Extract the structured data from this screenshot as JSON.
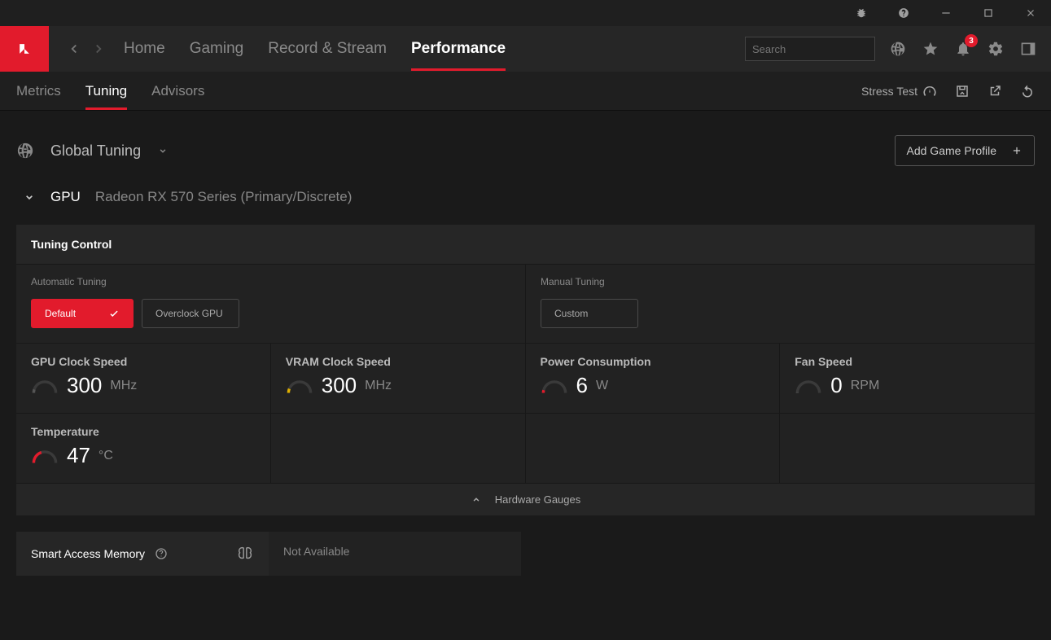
{
  "nav": {
    "home": "Home",
    "gaming": "Gaming",
    "record": "Record & Stream",
    "performance": "Performance"
  },
  "search": {
    "placeholder": "Search"
  },
  "notifications": {
    "count": "3"
  },
  "subtabs": {
    "metrics": "Metrics",
    "tuning": "Tuning",
    "advisors": "Advisors"
  },
  "subright": {
    "stress": "Stress Test"
  },
  "tuning": {
    "scope": "Global Tuning",
    "add_profile": "Add Game Profile",
    "gpu_label": "GPU",
    "gpu_name": "Radeon RX 570 Series (Primary/Discrete)",
    "panel_title": "Tuning Control",
    "auto_label": "Automatic Tuning",
    "manual_label": "Manual Tuning",
    "default_btn": "Default",
    "overclock_btn": "Overclock GPU",
    "custom_btn": "Custom"
  },
  "gauges": {
    "items": [
      {
        "title": "GPU Clock Speed",
        "value": "300",
        "unit": "MHz",
        "color": "#555",
        "fill": 0.1
      },
      {
        "title": "VRAM Clock Speed",
        "value": "300",
        "unit": "MHz",
        "color": "#e0b000",
        "fill": 0.12
      },
      {
        "title": "Power Consumption",
        "value": "6",
        "unit": "W",
        "color": "#e21b2c",
        "fill": 0.08
      },
      {
        "title": "Fan Speed",
        "value": "0",
        "unit": "RPM",
        "color": "#555",
        "fill": 0.02
      },
      {
        "title": "Temperature",
        "value": "47",
        "unit": "°C",
        "color": "#e21b2c",
        "fill": 0.4
      }
    ],
    "footer": "Hardware Gauges"
  },
  "sam": {
    "label": "Smart Access Memory",
    "value": "Not Available"
  }
}
